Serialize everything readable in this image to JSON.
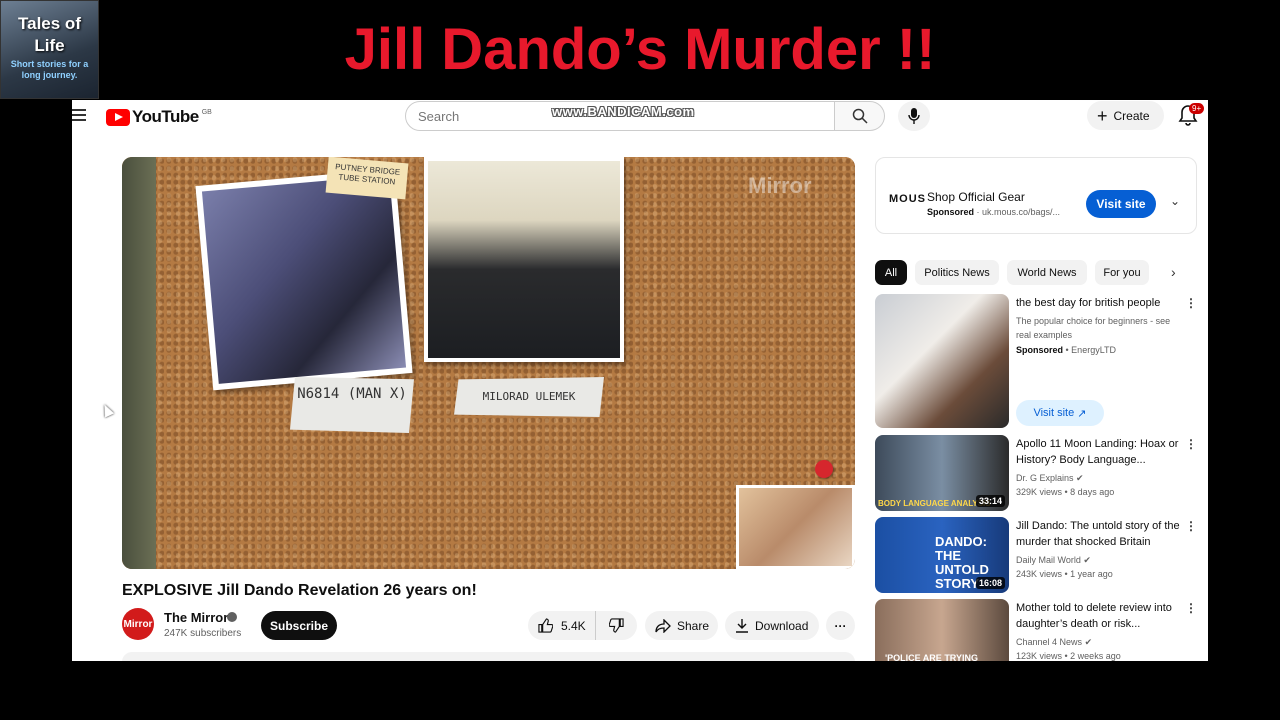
{
  "overlay": {
    "badge_title": "Tales of Life",
    "badge_subtitle": "Short stories for a long journey.",
    "headline": "Jill Dando’s Murder !!",
    "headline_color": "#e8192c"
  },
  "recording_watermark": "www.BANDICAM.com",
  "masthead": {
    "logo_text": "YouTube",
    "region": "GB",
    "search_placeholder": "Search",
    "create_label": "Create",
    "notification_count": "9+"
  },
  "video": {
    "title": "EXPLOSIVE Jill Dando Revelation 26 years on!",
    "frame_labels": {
      "station_tag": "PUTNEY BRIDGE TUBE STATION",
      "label_left": "N6814 (MAN X)",
      "label_right": "MILORAD ULEMEK",
      "watermark": "Mirror"
    },
    "channel": {
      "name": "The Mirror",
      "subscribers": "247K subscribers",
      "avatar_text": "Mirror"
    },
    "subscribe_label": "Subscribe",
    "likes": "5.4K",
    "share_label": "Share",
    "download_label": "Download"
  },
  "ad_card": {
    "brand": "MOUS",
    "title": "Shop Official Gear",
    "sponsored": "Sponsored",
    "url": "uk.mous.co/bags/...",
    "cta": "Visit site"
  },
  "chips": [
    "All",
    "Politics News",
    "World News",
    "For you"
  ],
  "recommendations": [
    {
      "title": "the best day for british people",
      "meta1": "The popular choice for beginners - see real examples",
      "meta2_bold": "Sponsored",
      "meta2": "• EnergyLTD",
      "cta": "Visit site",
      "is_ad": true
    },
    {
      "title": "Apollo 11 Moon Landing: Hoax or History? Body Language...",
      "channel": "Dr. G Explains",
      "stats": "329K views • 8 days ago",
      "duration": "33:14",
      "thumb_text": "BODY LANGUAGE ANALYSIS"
    },
    {
      "title": "Jill Dando: The untold story of the murder that shocked Britain",
      "channel": "Daily Mail World",
      "stats": "243K views • 1 year ago",
      "duration": "16:08",
      "thumb_text": "DANDO: THE UNTOLD STORY"
    },
    {
      "title": "Mother told to delete review into daughter’s death or risk...",
      "channel": "Channel 4 News",
      "stats": "123K views • 2 weeks ago",
      "thumb_text": "'POLICE ARE TRYING"
    }
  ]
}
